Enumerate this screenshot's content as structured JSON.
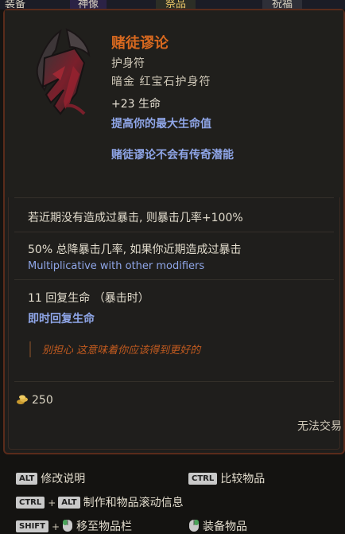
{
  "topbar": {
    "tabs": [
      "装备",
      "神像",
      "祭品",
      "祝福"
    ]
  },
  "item": {
    "name": "赌徒谬论",
    "type": "护身符",
    "base": "暗金 红宝石护身符",
    "implicit_stat": "+23 生命",
    "implicit_desc": "提高你的最大生命值",
    "legendary_note": "赌徒谬论不会有传奇潜能",
    "affixes": [
      {
        "text": "若近期没有造成过暴击, 则暴击几率+100%"
      },
      {
        "text": "50% 总降暴击几率, 如果你近期造成过暴击",
        "note": "Multiplicative with other modifiers"
      },
      {
        "text": "11 回复生命 （暴击时）",
        "note": "即时回复生命"
      }
    ],
    "flavor": "别担心 这意味着你应该得到更好的",
    "price": "250",
    "trade_status": "无法交易"
  },
  "hints": {
    "alt_key": "ALT",
    "ctrl_key": "CTRL",
    "shift_key": "SHIFT",
    "plus": "+",
    "modify_desc": "修改说明",
    "compare": "比较物品",
    "craft_scroll": "制作和物品滚动信息",
    "move_to_bar": "移至物品栏",
    "equip": "装备物品"
  },
  "colors": {
    "title": "#d9691f",
    "blue_text": "#8fa6e8",
    "flavor": "#c35b1f",
    "border": "#5a2b1b"
  },
  "icons": [
    "amulet-item-icon",
    "gold-coin-icon",
    "mouse-icon"
  ]
}
